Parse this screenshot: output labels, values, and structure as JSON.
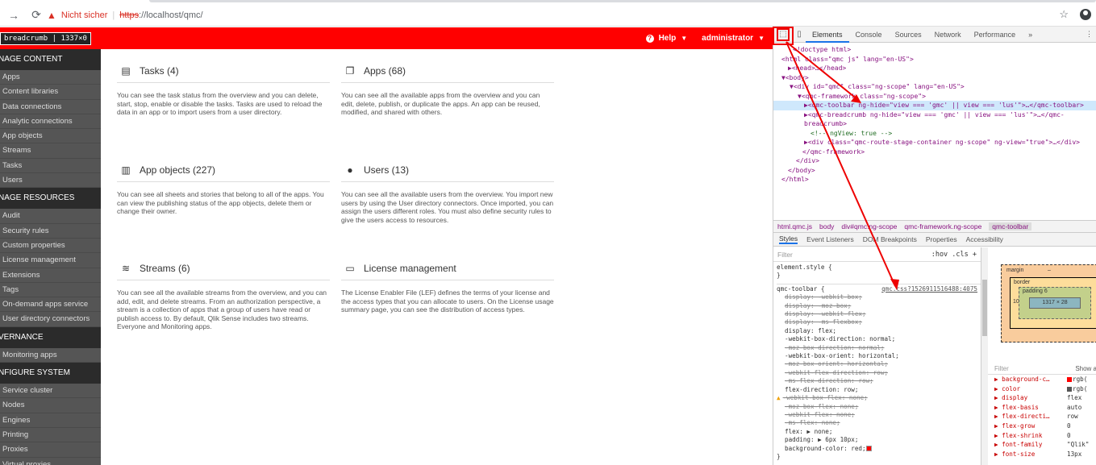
{
  "browser": {
    "insecure_label": "Nicht sicher",
    "url_proto": "https",
    "url_rest": "://localhost/qmc/"
  },
  "toolbar": {
    "breadcrumb_chip": "breadcrumb | 1337×0",
    "help": "Help",
    "user": "administrator"
  },
  "sidebar": {
    "sections": [
      {
        "title": "NAGE CONTENT",
        "items": [
          "Apps",
          "Content libraries",
          "Data connections",
          "Analytic connections",
          "App objects",
          "Streams",
          "Tasks",
          "Users"
        ]
      },
      {
        "title": "NAGE RESOURCES",
        "items": [
          "Audit",
          "Security rules",
          "Custom properties",
          "License management",
          "Extensions",
          "Tags",
          "On-demand apps service",
          "User directory connectors"
        ]
      },
      {
        "title": "VERNANCE",
        "items": [
          "Monitoring apps"
        ]
      },
      {
        "title": "NFIGURE SYSTEM",
        "items": [
          "Service cluster",
          "Nodes",
          "Engines",
          "Printing",
          "Proxies",
          "Virtual proxies"
        ]
      }
    ]
  },
  "tiles": [
    {
      "title": "Tasks (4)",
      "icon": "clipboard-icon",
      "desc": "You can see the task status from the overview and you can delete, start, stop, enable or disable the tasks. Tasks are used to reload the data in an app or to import users from a user directory."
    },
    {
      "title": "Apps (68)",
      "icon": "apps-window-icon",
      "desc": "You can see all the available apps from the overview and you can edit, delete, publish, or duplicate the apps. An app can be reused, modified, and shared with others."
    },
    {
      "title": "App objects (227)",
      "icon": "chart-icon",
      "desc": "You can see all sheets and stories that belong to all of the apps. You can view the publishing status of the app objects, delete them or change their owner."
    },
    {
      "title": "Users (13)",
      "icon": "user-icon",
      "desc": "You can see all the available users from the overview. You import new users by using the User directory connectors. Once imported, you can assign the users different roles. You must also define security rules to give the users access to resources."
    },
    {
      "title": "Streams (6)",
      "icon": "streams-icon",
      "desc": "You can see all the available streams from the overview, and you can add, edit, and delete streams. From an authorization perspective, a stream is a collection of apps that a group of users have read or publish access to. By default, Qlik Sense includes two streams. Everyone and Monitoring apps."
    },
    {
      "title": "License management",
      "icon": "license-icon",
      "desc": "The License Enabler File (LEF) defines the terms of your license and the access types that you can allocate to users. On the License usage summary page, you can see the distribution of access types."
    }
  ],
  "devtools": {
    "tabs": [
      "Elements",
      "Console",
      "Sources",
      "Network",
      "Performance"
    ],
    "more": "»",
    "dom_lines": [
      "<!doctype html>",
      "<html class=\"qmc js\" lang=\"en-US\">",
      "▶<head>…</head>",
      "▼<body>",
      "▼<div id=\"qmc\" class=\"ng-scope\" lang=\"en-US\">",
      "▼<qmc-framework class=\"ng-scope\">",
      "▶<qmc-toolbar ng-hide=\"view === 'gmc' || view === 'lus'\">…</qmc-toolbar>",
      "▶<qmc-breadcrumb ng-hide=\"view === 'gmc' || view === 'lus'\">…</qmc-",
      "breadcrumb>",
      "<!-- ngView: true -->",
      "▶<div class=\"qmc-route-stage-container ng-scope\" ng-view=\"true\">…</div>",
      "</qmc-framework>",
      "</div>",
      "</body>",
      "</html>"
    ],
    "crumbs": [
      "html.qmc.js",
      "body",
      "div#qmc.ng-scope",
      "qmc-framework.ng-scope",
      "qmc-toolbar"
    ],
    "subtabs": [
      "Styles",
      "Event Listeners",
      "DOM Breakpoints",
      "Properties",
      "Accessibility"
    ],
    "filter": "Filter",
    "filter_right": ":hov  .cls  +",
    "element_style": "element.style {",
    "close_brace": "}",
    "rule_selector": "qmc-toolbar {",
    "rule_source": "qmc.css?1526911516488:4075",
    "css_lines": [
      {
        "t": "display: -webkit-box;",
        "s": true
      },
      {
        "t": "display: -moz-box;",
        "s": true
      },
      {
        "t": "display: -webkit-flex;",
        "s": true
      },
      {
        "t": "display: -ms-flexbox;",
        "s": true
      },
      {
        "t": "display: flex;",
        "s": false
      },
      {
        "t": "-webkit-box-direction: normal;",
        "s": false
      },
      {
        "t": "-moz-box-direction: normal;",
        "s": true
      },
      {
        "t": "-webkit-box-orient: horizontal;",
        "s": false
      },
      {
        "t": "-moz-box-orient: horizontal;",
        "s": true
      },
      {
        "t": "-webkit-flex-direction: row;",
        "s": true
      },
      {
        "t": "-ms-flex-direction: row;",
        "s": true
      },
      {
        "t": "flex-direction: row;",
        "s": false
      },
      {
        "t": "-webkit-box-flex: none;",
        "s": true,
        "warn": true
      },
      {
        "t": "-moz-box-flex: none;",
        "s": true
      },
      {
        "t": "-webkit-flex: none;",
        "s": true
      },
      {
        "t": "-ms-flex: none;",
        "s": true
      },
      {
        "t": "flex: ▶ none;",
        "s": false
      },
      {
        "t": "padding: ▶ 6px 10px;",
        "s": false
      },
      {
        "t": "background-color: red;",
        "s": false,
        "swatch": true
      }
    ],
    "box_model": {
      "margin": "margin",
      "border": "border",
      "padding": "padding  6",
      "content": "1317 × 28",
      "side": "10",
      "dash": "–"
    },
    "computed_filter": "Filter",
    "computed_showall": "Show a",
    "computed": [
      {
        "p": "background-c…",
        "v": "rgb(",
        "sw": "#ff0000"
      },
      {
        "p": "color",
        "v": "rgb(",
        "sw": "#555555"
      },
      {
        "p": "display",
        "v": "flex"
      },
      {
        "p": "flex-basis",
        "v": "auto"
      },
      {
        "p": "flex-directi…",
        "v": "row"
      },
      {
        "p": "flex-grow",
        "v": "0"
      },
      {
        "p": "flex-shrink",
        "v": "0"
      },
      {
        "p": "font-family",
        "v": "\"Qlik\""
      },
      {
        "p": "font-size",
        "v": "13px"
      }
    ]
  }
}
